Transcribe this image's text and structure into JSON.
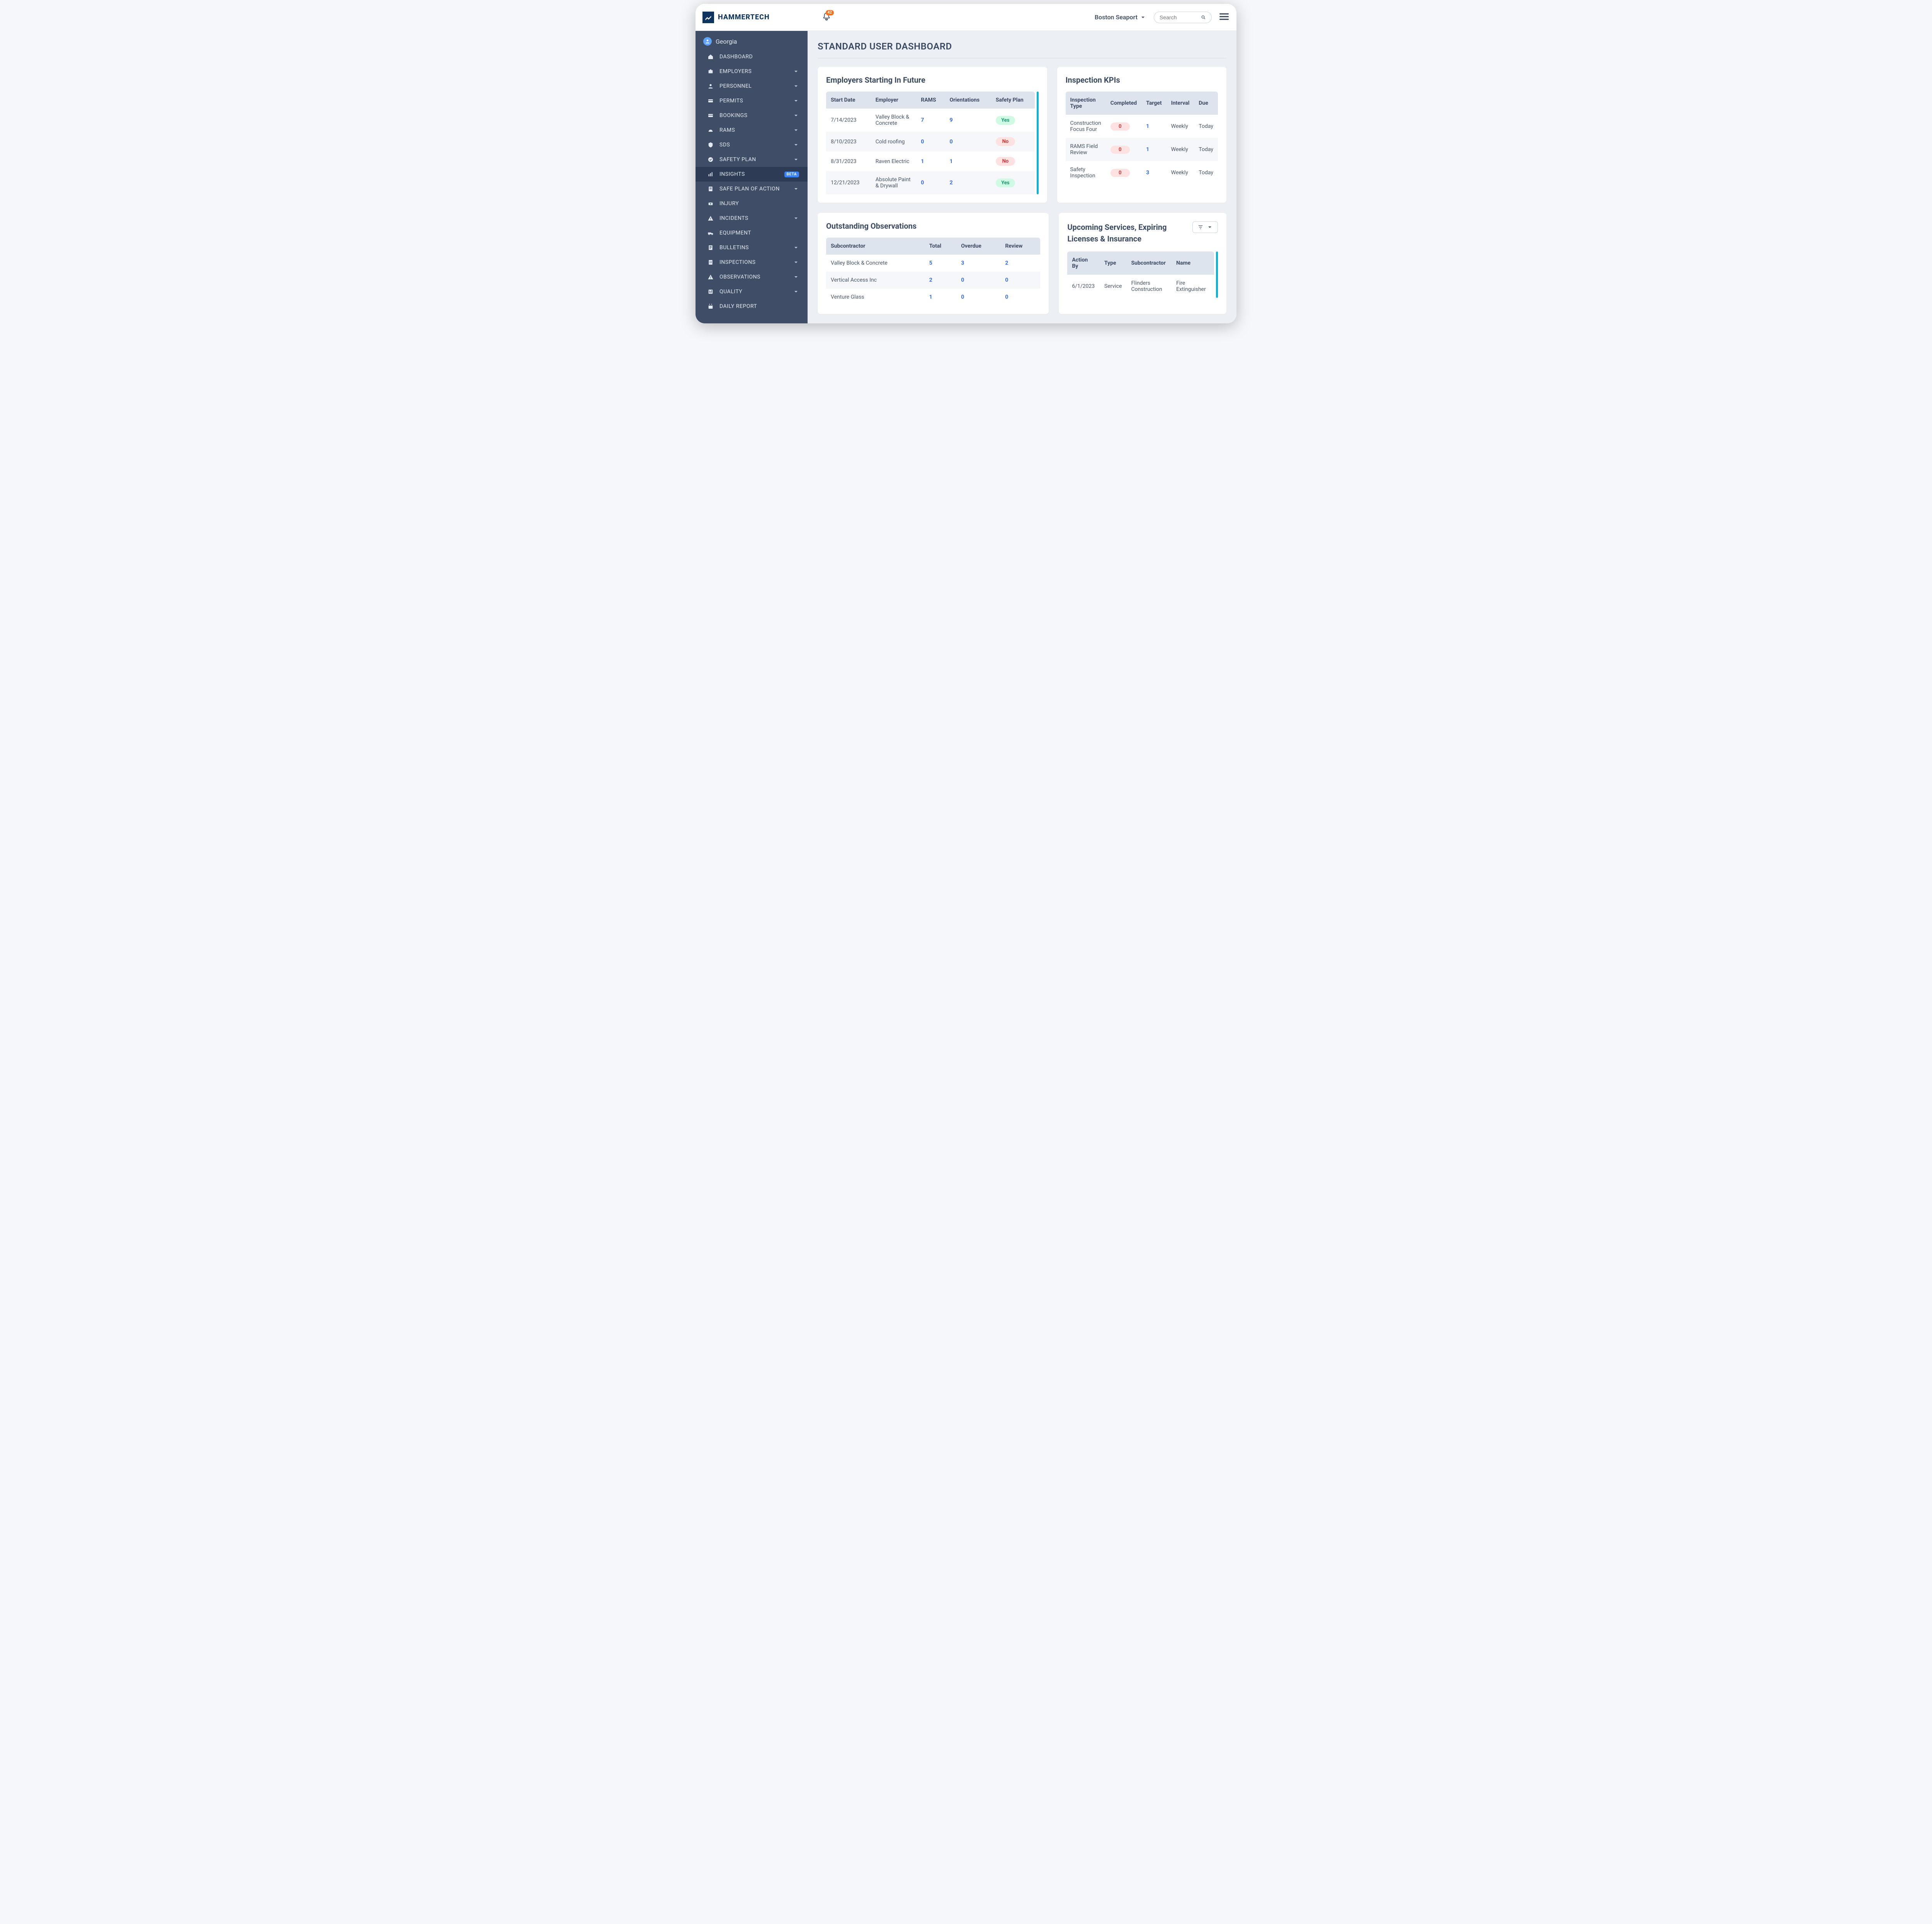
{
  "brand": "HAMMERTECH",
  "notif_count": "42",
  "project_name": "Boston Seaport",
  "search_placeholder": "Search",
  "user_name": "Georgia",
  "nav": [
    {
      "label": "DASHBOARD",
      "expandable": false
    },
    {
      "label": "EMPLOYERS",
      "expandable": true
    },
    {
      "label": "PERSONNEL",
      "expandable": true
    },
    {
      "label": "PERMITS",
      "expandable": true
    },
    {
      "label": "BOOKINGS",
      "expandable": true
    },
    {
      "label": "RAMS",
      "expandable": true
    },
    {
      "label": "SDS",
      "expandable": true
    },
    {
      "label": "SAFETY PLAN",
      "expandable": true
    },
    {
      "label": "INSIGHTS",
      "expandable": false,
      "badge": "BETA",
      "active": true
    },
    {
      "label": "SAFE PLAN OF ACTION",
      "expandable": true
    },
    {
      "label": "INJURY",
      "expandable": false
    },
    {
      "label": "INCIDENTS",
      "expandable": true
    },
    {
      "label": "EQUIPMENT",
      "expandable": false
    },
    {
      "label": "BULLETINS",
      "expandable": true
    },
    {
      "label": "INSPECTIONS",
      "expandable": true
    },
    {
      "label": "OBSERVATIONS",
      "expandable": true
    },
    {
      "label": "QUALITY",
      "expandable": true
    },
    {
      "label": "DAILY REPORT",
      "expandable": false
    }
  ],
  "page_title": "STANDARD USER DASHBOARD",
  "employers_card": {
    "title": "Employers Starting In Future",
    "headers": [
      "Start Date",
      "Employer",
      "RAMS",
      "Orientations",
      "Safety Plan"
    ],
    "rows": [
      {
        "date": "7/14/2023",
        "employer": "Valley Block & Concrete",
        "rams": "7",
        "orient": "9",
        "plan": "Yes"
      },
      {
        "date": "8/10/2023",
        "employer": "Cold roofing",
        "rams": "0",
        "orient": "0",
        "plan": "No"
      },
      {
        "date": "8/31/2023",
        "employer": "Raven Electric",
        "rams": "1",
        "orient": "1",
        "plan": "No"
      },
      {
        "date": "12/21/2023",
        "employer": "Absolute Paint & Drywall",
        "rams": "0",
        "orient": "2",
        "plan": "Yes"
      }
    ]
  },
  "kpi_card": {
    "title": "Inspection KPIs",
    "headers": [
      "Inspection Type",
      "Completed",
      "Target",
      "Interval",
      "Due"
    ],
    "rows": [
      {
        "type": "Construction Focus Four",
        "completed": "0",
        "target": "1",
        "interval": "Weekly",
        "due": "Today"
      },
      {
        "type": "RAMS Field Review",
        "completed": "0",
        "target": "1",
        "interval": "Weekly",
        "due": "Today"
      },
      {
        "type": "Safety Inspection",
        "completed": "0",
        "target": "3",
        "interval": "Weekly",
        "due": "Today"
      }
    ]
  },
  "obs_card": {
    "title": "Outstanding Observations",
    "headers": [
      "Subcontractor",
      "Total",
      "Overdue",
      "Review"
    ],
    "rows": [
      {
        "sub": "Valley Block & Concrete",
        "total": "5",
        "overdue": "3",
        "review": "2"
      },
      {
        "sub": "Vertical Access Inc",
        "total": "2",
        "overdue": "0",
        "review": "0"
      },
      {
        "sub": "Venture Glass",
        "total": "1",
        "overdue": "0",
        "review": "0"
      }
    ]
  },
  "upcoming_card": {
    "title": "Upcoming Services, Expiring Licenses & Insurance",
    "headers": [
      "Action By",
      "Type",
      "Subcontractor",
      "Name"
    ],
    "rows": [
      {
        "action": "6/1/2023",
        "type": "Service",
        "sub": "Flinders Construction",
        "name": "Fire Extinguisher"
      }
    ]
  }
}
